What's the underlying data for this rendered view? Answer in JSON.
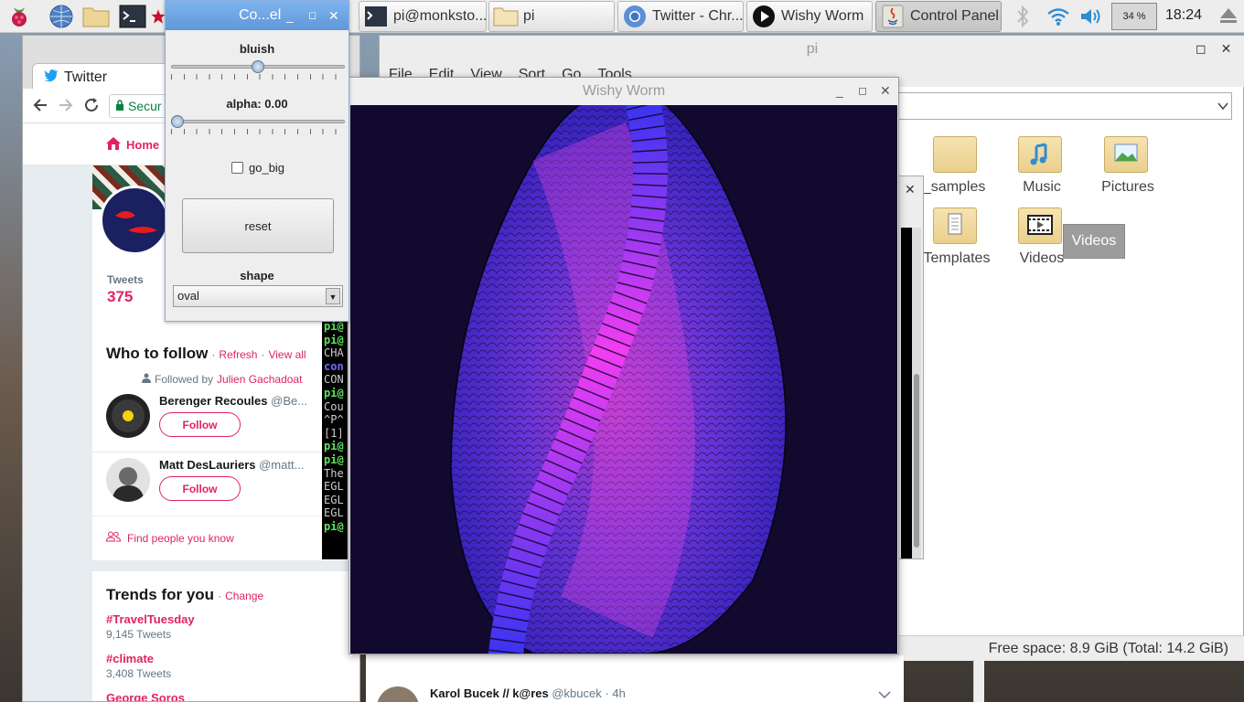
{
  "taskbar": {
    "buttons": [
      {
        "label": "Co...el"
      },
      {
        "label": "pi@monksto..."
      },
      {
        "label": "pi"
      },
      {
        "label": "Twitter - Chr..."
      },
      {
        "label": "Wishy Worm"
      },
      {
        "label": "Control Panel"
      }
    ],
    "cpu": "34 %",
    "clock": "18:24"
  },
  "chrome": {
    "tab_title": "Twitter",
    "secure_label": "Secur",
    "nav_home": "Home",
    "profile": {
      "tweets_label": "Tweets",
      "tweets_count": "375"
    },
    "who_to_follow": {
      "title": "Who to follow",
      "refresh": "Refresh",
      "view_all": "View all",
      "followed_by_prefix": "Followed by",
      "followed_by_name": "Julien Gachadoat",
      "users": [
        {
          "name": "Berenger Recoules",
          "handle": "@Be...",
          "button": "Follow"
        },
        {
          "name": "Matt DesLauriers",
          "handle": "@matt...",
          "button": "Follow"
        }
      ],
      "find_people": "Find people you know"
    },
    "trends": {
      "title": "Trends for you",
      "change": "Change",
      "items": [
        {
          "tag": "#TravelTuesday",
          "count": "9,145 Tweets"
        },
        {
          "tag": "#climate",
          "count": "3,408 Tweets"
        },
        {
          "tag": "George Soros",
          "count": ""
        }
      ]
    },
    "tweet_author": {
      "name": "Karol Bucek // k@res",
      "handle": "@kbucek",
      "time": "4h"
    }
  },
  "controls": {
    "title": "Co...el",
    "bluish_label": "bluish",
    "bluish_value": 0.5,
    "alpha_label": "alpha: 0.00",
    "alpha_value": 0.0,
    "go_big_label": "go_big",
    "reset_label": "reset",
    "shape_label": "shape",
    "shape_value": "oval"
  },
  "worm": {
    "title": "Wishy Worm"
  },
  "file_manager": {
    "title": "pi",
    "menu": [
      "File",
      "Edit",
      "View",
      "Sort",
      "Go",
      "Tools"
    ],
    "items": [
      {
        "label": "9_samples",
        "icon": "folder-icon"
      },
      {
        "label": "Music",
        "icon": "music-folder-icon"
      },
      {
        "label": "Pictures",
        "icon": "pictures-folder-icon"
      },
      {
        "label": "Templates",
        "icon": "templates-folder-icon"
      },
      {
        "label": "Videos",
        "icon": "videos-folder-icon"
      }
    ],
    "tooltip": "Videos",
    "status": "Free space: 8.9 GiB (Total: 14.2 GiB)"
  },
  "terminal": {
    "lines": [
      "pi@",
      "pi@",
      "CHA",
      "con",
      "CON",
      "pi@",
      "Cou",
      "^P^",
      "[1]",
      "pi@",
      "pi@",
      "The",
      "EGL",
      "EGL",
      "EGL",
      "pi@"
    ]
  }
}
